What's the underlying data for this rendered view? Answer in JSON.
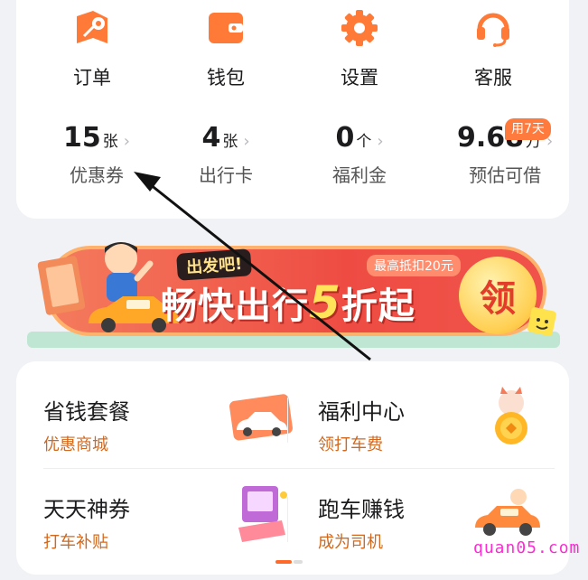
{
  "quick_actions": [
    {
      "label": "订单",
      "icon": "order-map-icon"
    },
    {
      "label": "钱包",
      "icon": "wallet-icon"
    },
    {
      "label": "设置",
      "icon": "gear-icon"
    },
    {
      "label": "客服",
      "icon": "headset-icon"
    }
  ],
  "stats": [
    {
      "value": "15",
      "unit": "张",
      "label": "优惠券"
    },
    {
      "value": "4",
      "unit": "张",
      "label": "出行卡"
    },
    {
      "value": "0",
      "unit": "个",
      "label": "福利金"
    },
    {
      "value": "9.68",
      "unit": "万",
      "label": "预估可借"
    }
  ],
  "stats_badge": "用7天",
  "stats_chevron": "›",
  "banner": {
    "tag": "出发吧!",
    "slogan_prefix": "畅快出行",
    "slogan_big": "5",
    "slogan_suffix": "折起",
    "sub": "最高抵扣20元",
    "button": "领"
  },
  "services": [
    {
      "title": "省钱套餐",
      "desc": "优惠商城",
      "icon": "ticket-car-icon"
    },
    {
      "title": "福利中心",
      "desc": "领打车费",
      "icon": "lucky-cat-coin-icon"
    },
    {
      "title": "天天神券",
      "desc": "打车补贴",
      "icon": "coupon-machine-icon"
    },
    {
      "title": "跑车赚钱",
      "desc": "成为司机",
      "icon": "driver-car-icon"
    }
  ],
  "watermark": "quan05.com",
  "colors": {
    "accent": "#ff6a2b",
    "desc_orange": "#d0691f",
    "banner_red": "#ee4c43"
  }
}
